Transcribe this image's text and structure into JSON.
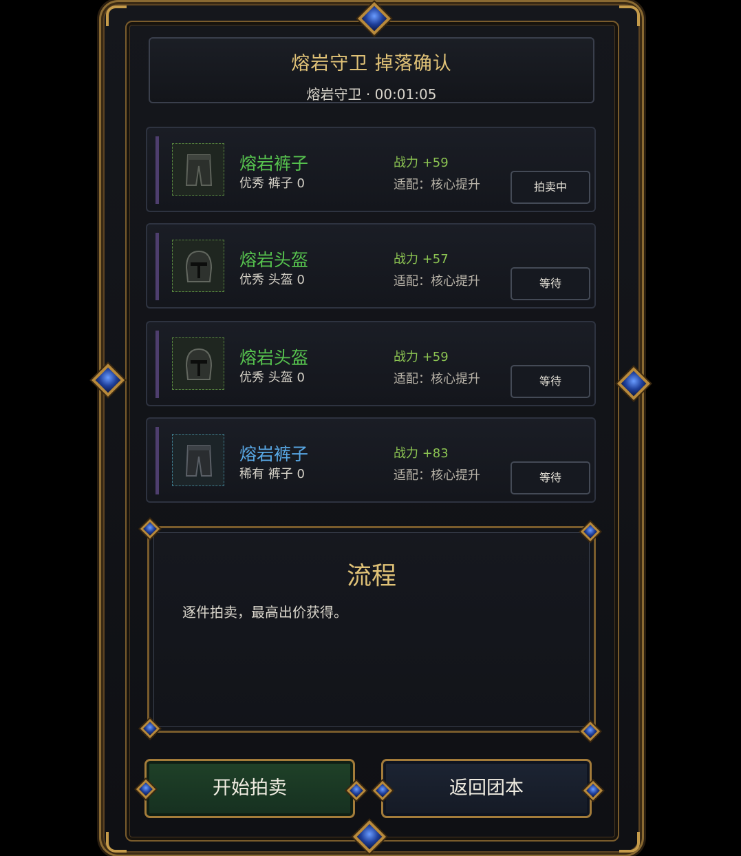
{
  "header": {
    "title": "熔岩守卫 掉落确认",
    "subtitle": "熔岩守卫 · 00:01:05"
  },
  "items": [
    {
      "name": "熔岩裤子",
      "quality": "优秀 裤子 0",
      "power": "战力 +59",
      "fit": "适配：核心提升",
      "status": "拍卖中",
      "rarity": "green",
      "icon": "pants-icon"
    },
    {
      "name": "熔岩头盔",
      "quality": "优秀 头盔 0",
      "power": "战力 +57",
      "fit": "适配：核心提升",
      "status": "等待",
      "rarity": "green",
      "icon": "helmet-icon"
    },
    {
      "name": "熔岩头盔",
      "quality": "优秀 头盔 0",
      "power": "战力 +59",
      "fit": "适配：核心提升",
      "status": "等待",
      "rarity": "green",
      "icon": "helmet-icon"
    },
    {
      "name": "熔岩裤子",
      "quality": "稀有 裤子 0",
      "power": "战力 +83",
      "fit": "适配：核心提升",
      "status": "等待",
      "rarity": "blue",
      "icon": "pants-icon"
    }
  ],
  "process": {
    "title": "流程",
    "text": "逐件拍卖，最高出价获得。"
  },
  "buttons": {
    "start": "开始拍卖",
    "back": "返回团本"
  },
  "colors": {
    "gold": "#e0c277",
    "excellent": "#56c24e",
    "rare": "#58a7e4"
  }
}
